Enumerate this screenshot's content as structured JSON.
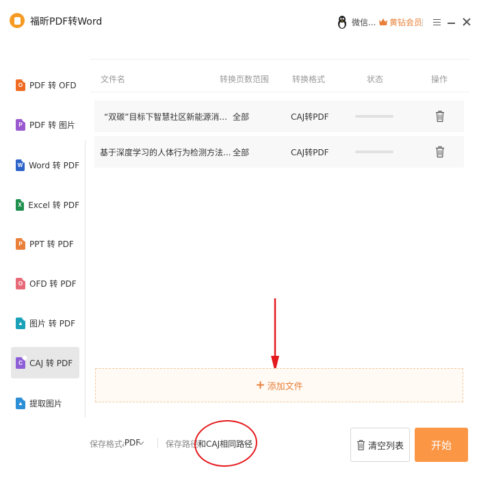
{
  "app": {
    "title": "福昕PDF转Word"
  },
  "header": {
    "user_name": "微信...",
    "vip_label": "黄钻会员"
  },
  "sidebar": {
    "items": [
      {
        "label": "PDF 转 OFD",
        "icon": "pdf-to-ofd-icon",
        "letter": "O",
        "color": "#ef6b24"
      },
      {
        "label": "PDF 转 图片",
        "icon": "pdf-to-image-icon",
        "letter": "P",
        "color": "#9b59d0"
      },
      {
        "label": "Word 转 PDF",
        "icon": "word-to-pdf-icon",
        "letter": "W",
        "color": "#2b63c8"
      },
      {
        "label": "Excel 转 PDF",
        "icon": "excel-to-pdf-icon",
        "letter": "X",
        "color": "#1f8f4e"
      },
      {
        "label": "PPT 转 PDF",
        "icon": "ppt-to-pdf-icon",
        "letter": "P",
        "color": "#e8803a"
      },
      {
        "label": "OFD 转 PDF",
        "icon": "ofd-to-pdf-icon",
        "letter": "O",
        "color": "#e66a78"
      },
      {
        "label": "图片 转 PDF",
        "icon": "image-to-pdf-icon",
        "letter": "▲",
        "color": "#1aa1b8"
      },
      {
        "label": "CAJ 转 PDF",
        "icon": "caj-to-pdf-icon",
        "letter": "C",
        "color": "#8e5fd6"
      },
      {
        "label": "提取图片",
        "icon": "extract-image-icon",
        "letter": "▲",
        "color": "#2d8fd6"
      }
    ],
    "active_index": 7
  },
  "table": {
    "headers": {
      "name": "文件名",
      "range": "转换页数范围",
      "format": "转换格式",
      "status": "状态",
      "action": "操作"
    },
    "rows": [
      {
        "name": "“双碳”目标下智慧社区新能源消...",
        "range": "全部",
        "format": "CAJ转PDF",
        "progress": 0
      },
      {
        "name": "基于深度学习的人体行为检测方法...",
        "range": "全部",
        "format": "CAJ转PDF",
        "progress": 0
      }
    ]
  },
  "add_file_label": "添加文件",
  "footer": {
    "format_label": "保存格式:",
    "format_value": ".PDF",
    "path_label": "保存路径:",
    "path_value": "和CAJ相同路径"
  },
  "buttons": {
    "clear": "清空列表",
    "start": "开始"
  },
  "colors": {
    "accent": "#fb9645",
    "annotation": "#e4191c"
  }
}
